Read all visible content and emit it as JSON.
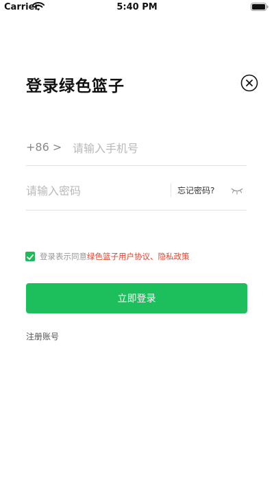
{
  "status_bar": {
    "carrier": "Carrier",
    "time": "5:40 PM",
    "icons": [
      "wifi-icon",
      "battery-icon"
    ]
  },
  "page": {
    "title": "登录绿色篮子",
    "close_icon": "close-circle-icon"
  },
  "phone": {
    "prefix": "+86 >",
    "placeholder": "请输入手机号"
  },
  "password": {
    "placeholder": "请输入密码",
    "forgot_label": "忘记密码?",
    "toggle_icon": "eye-closed-icon"
  },
  "agreement": {
    "checked": true,
    "text": "登录表示同意",
    "links": "绿色篮子用户协议、隐私政策"
  },
  "login_button": {
    "label": "立即登录"
  },
  "register_link": {
    "label": "注册账号"
  },
  "colors": {
    "accent": "#1dbf5c",
    "link": "#e2452f",
    "placeholder": "#b9b9b9",
    "divider": "#e3e3e3"
  }
}
